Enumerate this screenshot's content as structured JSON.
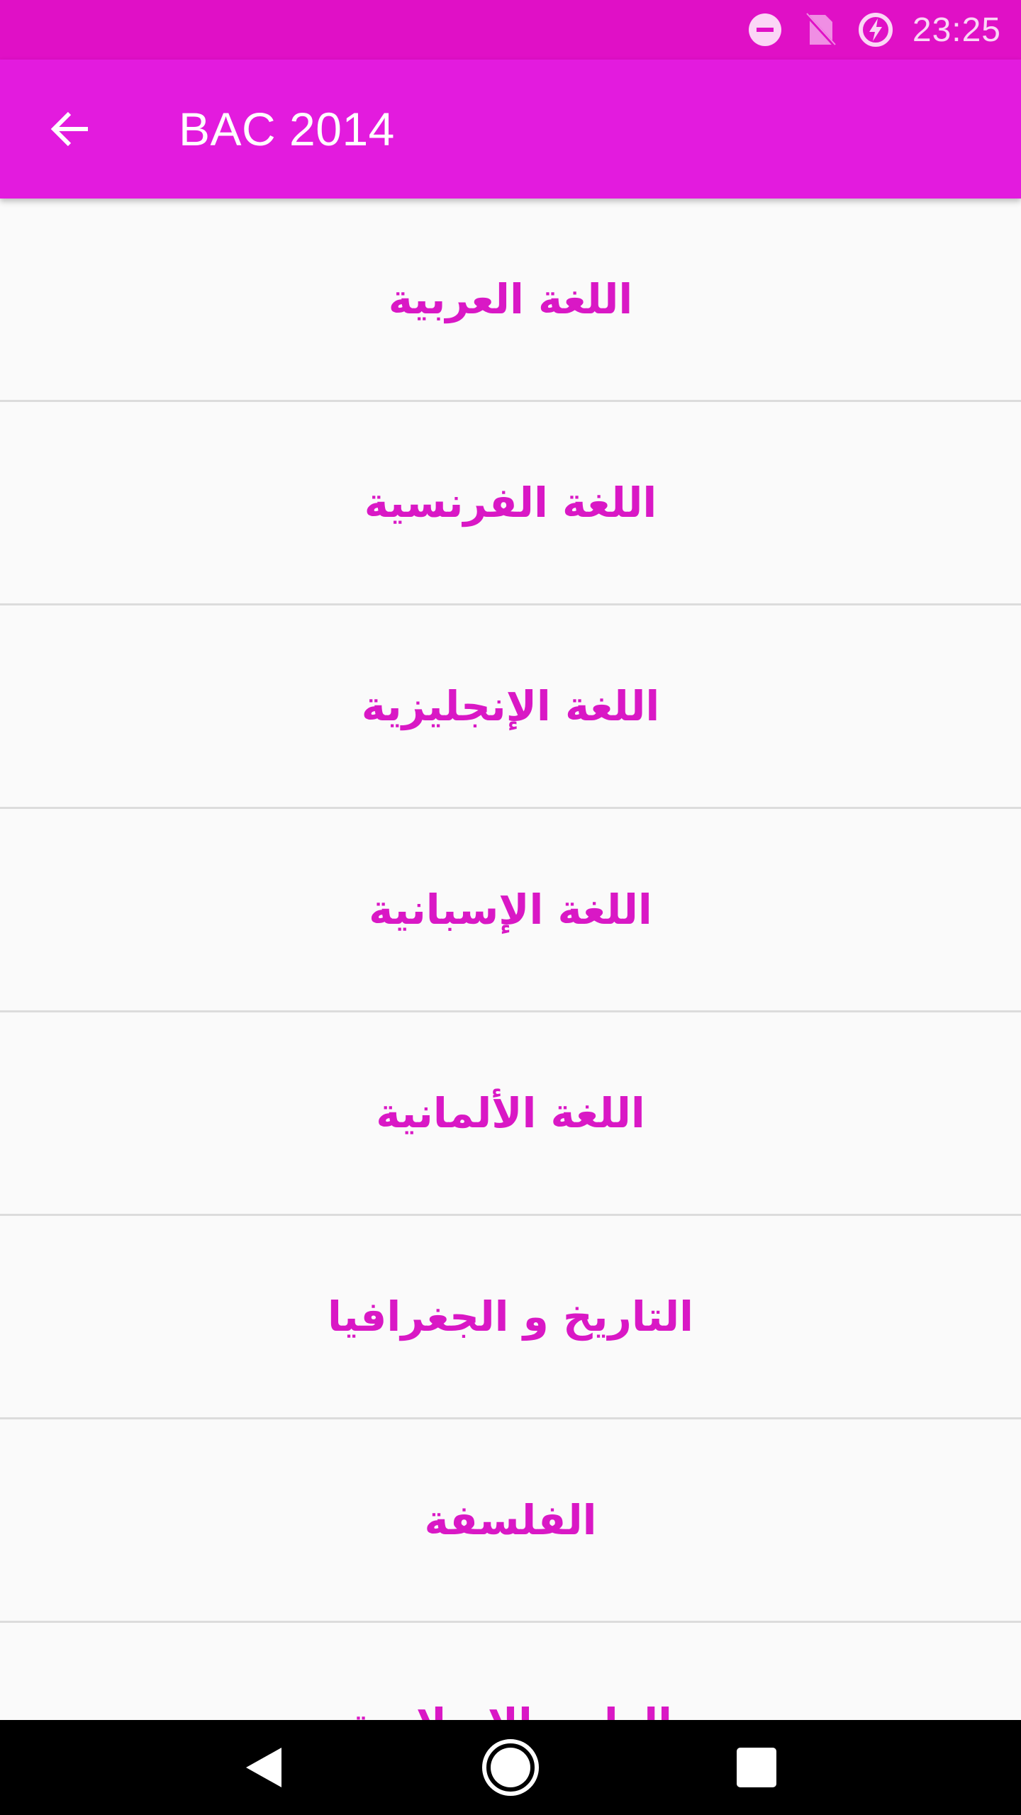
{
  "status_bar": {
    "time": "23:25",
    "icons": [
      "do-not-disturb-icon",
      "no-sim-icon",
      "battery-saver-icon"
    ]
  },
  "app_bar": {
    "title": "BAC 2014",
    "back_icon": "arrow-back-icon"
  },
  "colors": {
    "status_bar": "#e010c6",
    "app_bar": "#e31bde",
    "item_text": "#d918c5",
    "divider": "#dcdcdc",
    "background": "#fafafa"
  },
  "subjects": [
    {
      "label": "اللغة العربية"
    },
    {
      "label": "اللغة الفرنسية"
    },
    {
      "label": "اللغة الإنجليزية"
    },
    {
      "label": "اللغة الإسبانية"
    },
    {
      "label": "اللغة الألمانية"
    },
    {
      "label": "التاريخ و الجغرافيا"
    },
    {
      "label": "الفلسفة"
    },
    {
      "label": "العلوم الإسلامية"
    }
  ],
  "nav_bar": {
    "buttons": [
      "back-triangle-icon",
      "home-circle-icon",
      "recents-square-icon"
    ]
  }
}
